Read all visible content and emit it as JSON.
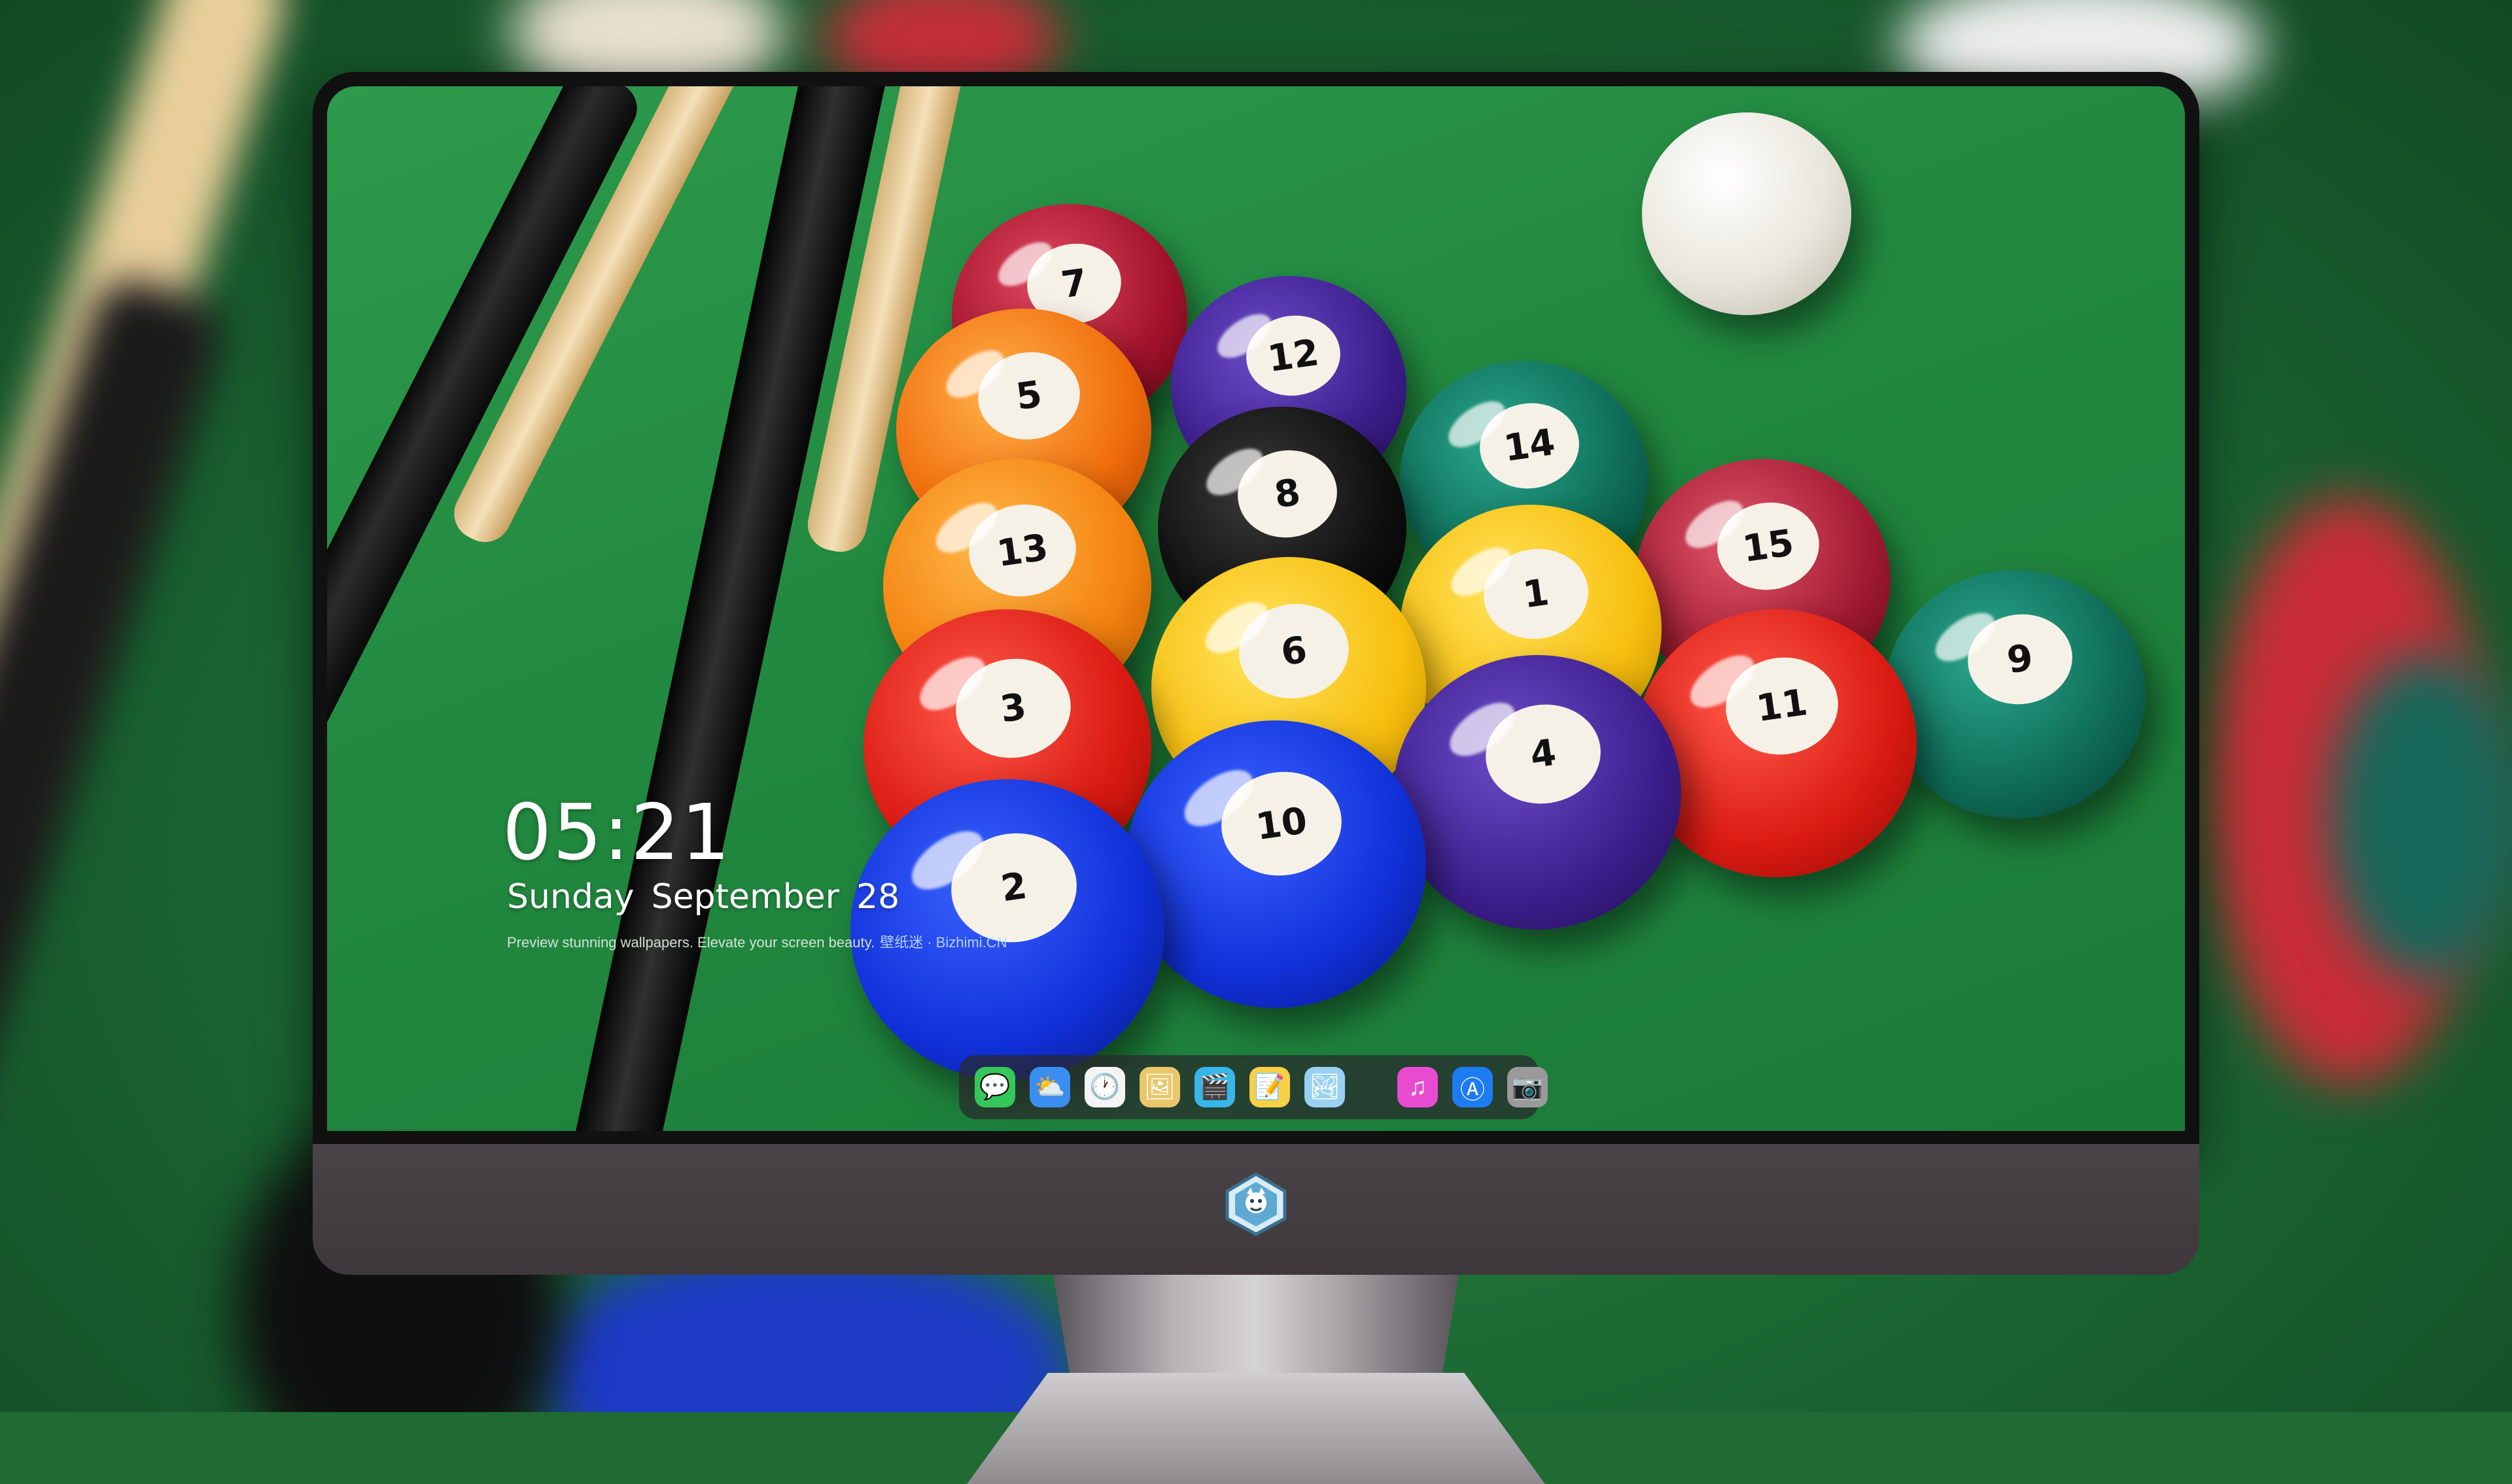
{
  "lock_screen": {
    "time": "05:21",
    "weekday": "Sunday",
    "month": "September",
    "day": "28",
    "tagline": "Preview stunning wallpapers. Elevate your screen beauty.",
    "brand": "壁纸迷 · Bizhimi.CN"
  },
  "balls": [
    {
      "n": "7"
    },
    {
      "n": "12"
    },
    {
      "n": "5"
    },
    {
      "n": "14"
    },
    {
      "n": "8"
    },
    {
      "n": "13"
    },
    {
      "n": "15"
    },
    {
      "n": "1"
    },
    {
      "n": "6"
    },
    {
      "n": "3"
    },
    {
      "n": "9"
    },
    {
      "n": "11"
    },
    {
      "n": "4"
    },
    {
      "n": "10"
    },
    {
      "n": "2"
    }
  ],
  "dock": {
    "apps": [
      {
        "name": "messages-icon",
        "color": "#34c759",
        "glyph": "💬"
      },
      {
        "name": "weather-icon",
        "color": "#3a8ef0",
        "glyph": "⛅"
      },
      {
        "name": "clock-icon",
        "color": "#f4f4f4",
        "glyph": "🕐"
      },
      {
        "name": "preview-icon",
        "color": "#e9c76a",
        "glyph": "🖼"
      },
      {
        "name": "video-editor-icon",
        "color": "#38b6e8",
        "glyph": "🎬"
      },
      {
        "name": "notes-icon",
        "color": "#f7d046",
        "glyph": "📝"
      },
      {
        "name": "photos-icon",
        "color": "#9ad1f2",
        "glyph": "🏞"
      },
      {
        "name": "music-icon",
        "color": "#e94bd0",
        "glyph": "♫"
      },
      {
        "name": "app-store-icon",
        "color": "#1d7cf2",
        "glyph": "Ⓐ"
      },
      {
        "name": "camera-icon",
        "color": "#9a9a9a",
        "glyph": "📷"
      }
    ]
  }
}
